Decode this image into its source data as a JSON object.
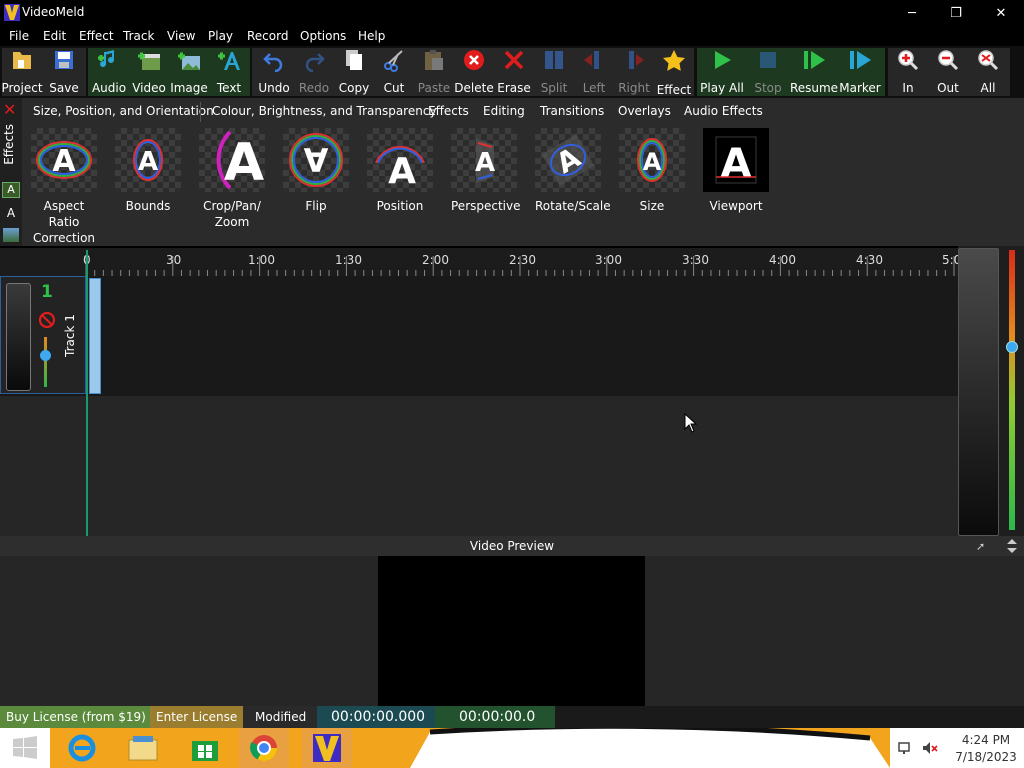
{
  "app": {
    "title": "VideoMeld",
    "brand_color": "#f0c020"
  },
  "window_controls": {
    "minimize": "─",
    "restore": "❐",
    "close": "✕"
  },
  "menu": [
    "File",
    "Edit",
    "Effect",
    "Track",
    "View",
    "Play",
    "Record",
    "Options",
    "Help"
  ],
  "toolbar": {
    "project": "Project",
    "save": "Save",
    "audio": "Audio",
    "video": "Video",
    "image": "Image",
    "text": "Text",
    "undo": "Undo",
    "redo": "Redo",
    "copy": "Copy",
    "cut": "Cut",
    "paste": "Paste",
    "delete": "Delete",
    "erase": "Erase",
    "split": "Split",
    "left": "Left",
    "right": "Right",
    "effect": "Effect",
    "play_all": "Play All",
    "stop": "Stop",
    "resume": "Resume",
    "marker": "Marker",
    "zoom_in": "In",
    "zoom_out": "Out",
    "zoom_all": "All"
  },
  "effects_panel": {
    "side_label": "Effects",
    "tabs": [
      "Size, Position, and Orientation",
      "Colour, Brightness, and Transparency",
      "Effects",
      "Editing",
      "Transitions",
      "Overlays",
      "Audio Effects"
    ],
    "tiles": [
      "Aspect Ratio Correction",
      "Bounds",
      "Crop/Pan/ Zoom",
      "Flip",
      "Position",
      "Perspective",
      "Rotate/Scale",
      "Size",
      "Viewport"
    ]
  },
  "timeline": {
    "ruler": [
      "0",
      "30",
      "1:00",
      "1:30",
      "2:00",
      "2:30",
      "3:00",
      "3:30",
      "4:00",
      "4:30",
      "5:0"
    ],
    "track": {
      "number": "1",
      "name": "Track 1"
    }
  },
  "preview": {
    "title": "Video Preview"
  },
  "status": {
    "buy": "Buy License (from $19)",
    "enter": "Enter License",
    "modified": "Modified",
    "time1": "00:00:00.000",
    "time2": "00:00:00.0"
  },
  "tray": {
    "time": "4:24 PM",
    "date": "7/18/2023"
  }
}
